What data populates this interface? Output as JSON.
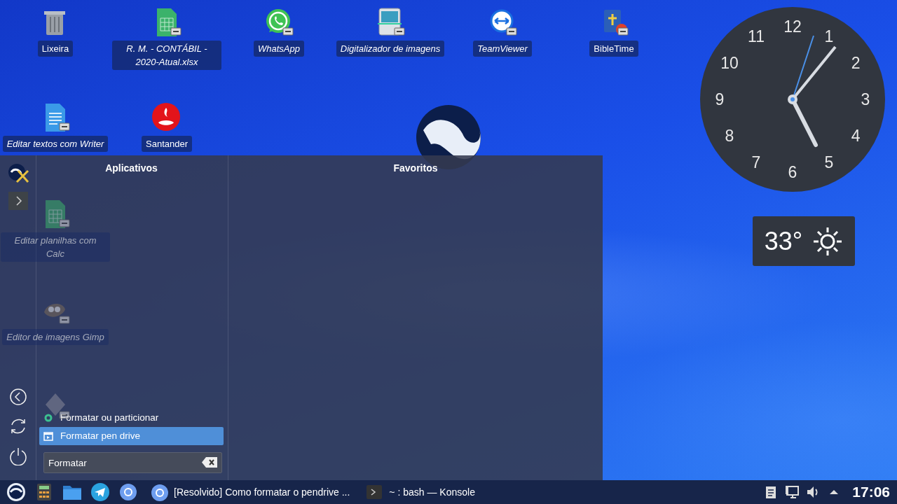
{
  "desktop_icons": [
    {
      "label": "Lixeira",
      "kind": "trash",
      "shortcut": false,
      "italic": false,
      "dimmed": false
    },
    {
      "label": "R. M. - CONTÁBIL - 2020-Atual.xlsx",
      "kind": "spreadsheet",
      "shortcut": true,
      "italic": true,
      "dimmed": false
    },
    {
      "label": "WhatsApp",
      "kind": "chat",
      "shortcut": true,
      "italic": true,
      "dimmed": false
    },
    {
      "label": "Digitalizador de imagens",
      "kind": "scanner",
      "shortcut": true,
      "italic": true,
      "dimmed": false
    },
    {
      "label": "TeamViewer",
      "kind": "arrows",
      "shortcut": true,
      "italic": true,
      "dimmed": false
    },
    {
      "label": "BibleTime",
      "kind": "book",
      "shortcut": true,
      "italic": false,
      "dimmed": false
    },
    {
      "label": "Editar textos com Writer",
      "kind": "document",
      "shortcut": true,
      "italic": true,
      "dimmed": false
    },
    {
      "label": "Santander",
      "kind": "flame",
      "shortcut": false,
      "italic": false,
      "dimmed": false
    },
    {
      "label": "Editar planilhas com Calc",
      "kind": "spreadsheet",
      "shortcut": true,
      "italic": true,
      "dimmed": true
    },
    {
      "label": "Editor de imagens Gimp",
      "kind": "mascot",
      "shortcut": true,
      "italic": true,
      "dimmed": true
    },
    {
      "kind": "generic",
      "shortcut": true,
      "dimmed": true
    }
  ],
  "clock": {
    "numerals": [
      "12",
      "1",
      "2",
      "3",
      "4",
      "5",
      "6",
      "7",
      "8",
      "9",
      "10",
      "11"
    ]
  },
  "weather": {
    "temperature": "33°"
  },
  "menu": {
    "sidebar": [
      {
        "kind": "logo"
      },
      {
        "kind": "expand"
      },
      {
        "kind": "back"
      },
      {
        "kind": "refresh"
      },
      {
        "kind": "power"
      }
    ],
    "applications_header": "Aplicativos",
    "favorites_header": "Favoritos",
    "results": [
      {
        "label": "Formatar ou particionar",
        "kind": "dot",
        "selected": false
      },
      {
        "label": "Formatar pen drive",
        "kind": "window",
        "selected": true
      }
    ],
    "search": {
      "value": "Formatar"
    }
  },
  "taskbar": {
    "launchers": [
      {
        "kind": "logo"
      },
      {
        "kind": "calculator"
      },
      {
        "kind": "folder"
      },
      {
        "kind": "plane"
      },
      {
        "kind": "browser"
      }
    ],
    "tasks": [
      {
        "label": "[Resolvido] Como formatar o pendrive ...",
        "kind": "browser"
      },
      {
        "label": "~ : bash — Konsole",
        "kind": "terminal"
      }
    ],
    "tray": [
      {
        "kind": "clipboard"
      },
      {
        "kind": "network"
      },
      {
        "kind": "speaker"
      },
      {
        "kind": "caret"
      }
    ],
    "time": "17:06"
  }
}
